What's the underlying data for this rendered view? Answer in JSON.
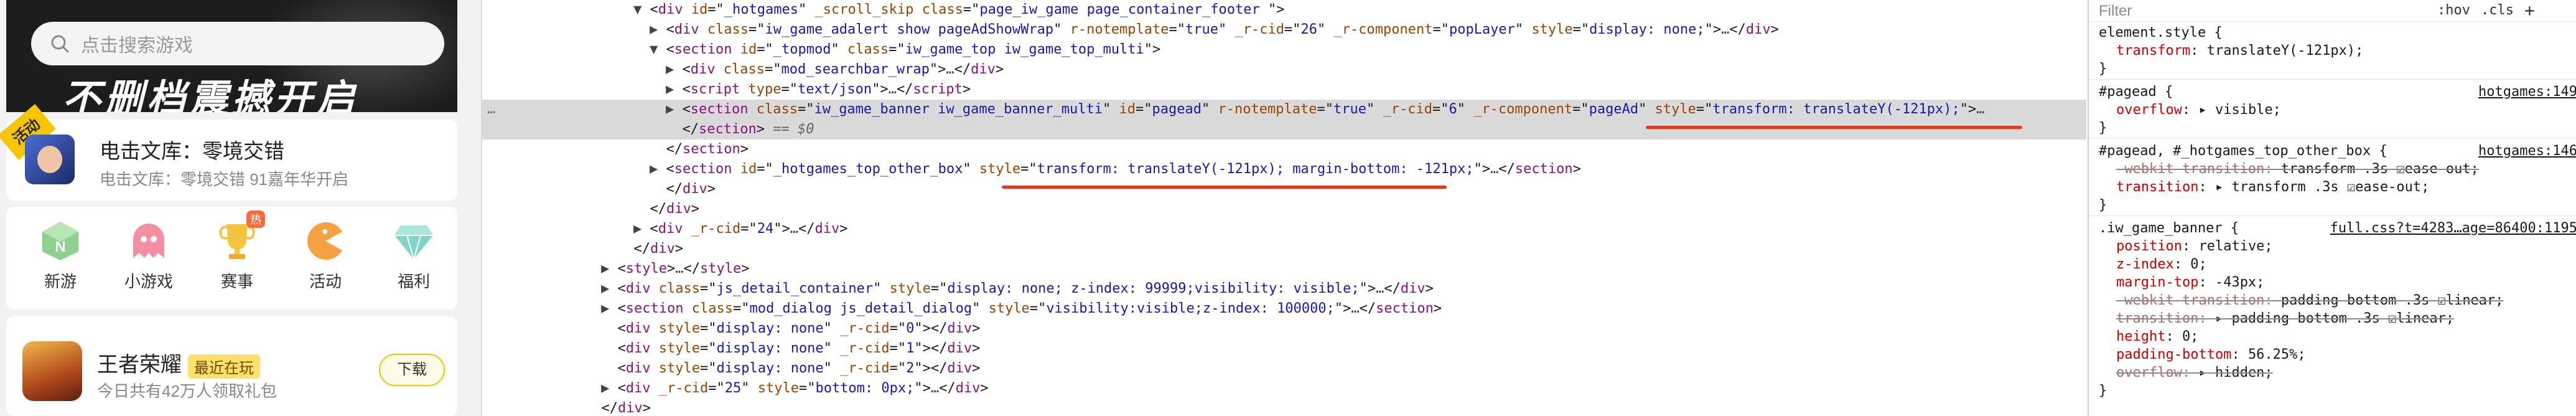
{
  "preview": {
    "search_placeholder": "点击搜索游戏",
    "banner_text": "不删档震撼开启",
    "activity": {
      "badge": "活动",
      "title": "电击文库：零境交错",
      "subtitle": "电击文库：零境交错 91嘉年华开启"
    },
    "nav": [
      {
        "label": "新游",
        "icon": "new-game-icon",
        "color": "#8fd08f"
      },
      {
        "label": "小游戏",
        "icon": "ghost-icon",
        "color": "#f28fa3"
      },
      {
        "label": "赛事",
        "icon": "trophy-icon",
        "color": "#f5c542",
        "badge": "热"
      },
      {
        "label": "活动",
        "icon": "pacman-icon",
        "color": "#f5a142"
      },
      {
        "label": "福利",
        "icon": "diamond-icon",
        "color": "#7fd6c8"
      }
    ],
    "game": {
      "title": "王者荣耀",
      "tag": "最近在玩",
      "subtitle": "今日共有42万人领取礼包",
      "button": "下载"
    }
  },
  "elements": {
    "lines": [
      {
        "indent": 0,
        "tri": "▼",
        "parts": [
          [
            "pun",
            "<"
          ],
          [
            "tag",
            "div"
          ],
          [
            "an",
            " id"
          ],
          [
            "pun",
            "=\""
          ],
          [
            "av",
            "_hotgames"
          ],
          [
            "pun",
            "\" "
          ],
          [
            "an",
            "_scroll_skip"
          ],
          [
            "an",
            " class"
          ],
          [
            "pun",
            "=\""
          ],
          [
            "av",
            "page_iw_game page_container_footer "
          ],
          [
            "pun",
            "\">"
          ]
        ]
      },
      {
        "indent": 1,
        "tri": "▶",
        "parts": [
          [
            "pun",
            "<"
          ],
          [
            "tag",
            "div"
          ],
          [
            "an",
            " class"
          ],
          [
            "pun",
            "=\""
          ],
          [
            "av",
            "iw_game_adalert show pageAdShowWrap"
          ],
          [
            "pun",
            "\" "
          ],
          [
            "an",
            "r-notemplate"
          ],
          [
            "pun",
            "=\""
          ],
          [
            "av",
            "true"
          ],
          [
            "pun",
            "\" "
          ],
          [
            "an",
            "_r-cid"
          ],
          [
            "pun",
            "=\""
          ],
          [
            "av",
            "26"
          ],
          [
            "pun",
            "\" "
          ],
          [
            "an",
            "_r-component"
          ],
          [
            "pun",
            "=\""
          ],
          [
            "av",
            "popLayer"
          ],
          [
            "pun",
            "\" "
          ],
          [
            "an",
            "style"
          ],
          [
            "pun",
            "=\""
          ],
          [
            "av",
            "display: none;"
          ],
          [
            "pun",
            "\">"
          ],
          [
            "ell",
            "…"
          ],
          [
            "pun",
            "</"
          ],
          [
            "tag",
            "div"
          ],
          [
            "pun",
            ">"
          ]
        ]
      },
      {
        "indent": 1,
        "tri": "▼",
        "parts": [
          [
            "pun",
            "<"
          ],
          [
            "tag",
            "section"
          ],
          [
            "an",
            " id"
          ],
          [
            "pun",
            "=\""
          ],
          [
            "av",
            "_topmod"
          ],
          [
            "pun",
            "\" "
          ],
          [
            "an",
            "class"
          ],
          [
            "pun",
            "=\""
          ],
          [
            "av",
            "iw_game_top iw_game_top_multi"
          ],
          [
            "pun",
            "\">"
          ]
        ]
      },
      {
        "indent": 2,
        "tri": "▶",
        "parts": [
          [
            "pun",
            "<"
          ],
          [
            "tag",
            "div"
          ],
          [
            "an",
            " class"
          ],
          [
            "pun",
            "=\""
          ],
          [
            "av",
            "mod_searchbar_wrap"
          ],
          [
            "pun",
            "\">"
          ],
          [
            "ell",
            "…"
          ],
          [
            "pun",
            "</"
          ],
          [
            "tag",
            "div"
          ],
          [
            "pun",
            ">"
          ]
        ]
      },
      {
        "indent": 2,
        "tri": "▶",
        "parts": [
          [
            "pun",
            "<"
          ],
          [
            "tag",
            "script"
          ],
          [
            "an",
            " type"
          ],
          [
            "pun",
            "=\""
          ],
          [
            "av",
            "text/json"
          ],
          [
            "pun",
            "\">"
          ],
          [
            "ell",
            "…"
          ],
          [
            "pun",
            "</"
          ],
          [
            "tag",
            "script"
          ],
          [
            "pun",
            ">"
          ]
        ]
      },
      {
        "indent": 2,
        "tri": "▶",
        "selected": true,
        "parts": [
          [
            "pun",
            "<"
          ],
          [
            "tag",
            "section"
          ],
          [
            "an",
            " class"
          ],
          [
            "pun",
            "=\""
          ],
          [
            "av",
            "iw_game_banner iw_game_banner_multi"
          ],
          [
            "pun",
            "\" "
          ],
          [
            "an",
            "id"
          ],
          [
            "pun",
            "=\""
          ],
          [
            "av",
            "pagead"
          ],
          [
            "pun",
            "\" "
          ],
          [
            "an",
            "r-notemplate"
          ],
          [
            "pun",
            "=\""
          ],
          [
            "av",
            "true"
          ],
          [
            "pun",
            "\" "
          ],
          [
            "an",
            "_r-cid"
          ],
          [
            "pun",
            "=\""
          ],
          [
            "av",
            "6"
          ],
          [
            "pun",
            "\" "
          ],
          [
            "an",
            "_r-component"
          ],
          [
            "pun",
            "=\""
          ],
          [
            "av",
            "pageAd"
          ],
          [
            "pun",
            "\" "
          ],
          [
            "an",
            "style"
          ],
          [
            "pun",
            "=\""
          ],
          [
            "av",
            "transform: translateY(-121px);"
          ],
          [
            "pun",
            "\">"
          ],
          [
            "ell",
            "…"
          ]
        ]
      },
      {
        "indent": 2,
        "tri": "",
        "selected": true,
        "parts": [
          [
            "pun",
            "</"
          ],
          [
            "tag",
            "section"
          ],
          [
            "pun",
            ">"
          ],
          [
            "cmt",
            " == $0"
          ]
        ]
      },
      {
        "indent": 1,
        "tri": "",
        "parts": [
          [
            "pun",
            "</"
          ],
          [
            "tag",
            "section"
          ],
          [
            "pun",
            ">"
          ]
        ]
      },
      {
        "indent": 1,
        "tri": "▶",
        "parts": [
          [
            "pun",
            "<"
          ],
          [
            "tag",
            "section"
          ],
          [
            "an",
            " id"
          ],
          [
            "pun",
            "=\""
          ],
          [
            "av",
            "_hotgames_top_other_box"
          ],
          [
            "pun",
            "\" "
          ],
          [
            "an",
            "style"
          ],
          [
            "pun",
            "=\""
          ],
          [
            "av",
            "transform: translateY(-121px); margin-bottom: -121px;"
          ],
          [
            "pun",
            "\">"
          ],
          [
            "ell",
            "…"
          ],
          [
            "pun",
            "</"
          ],
          [
            "tag",
            "section"
          ],
          [
            "pun",
            ">"
          ]
        ]
      },
      {
        "indent": 1,
        "tri": "",
        "parts": [
          [
            "pun",
            "</"
          ],
          [
            "tag",
            "div"
          ],
          [
            "pun",
            ">"
          ]
        ]
      },
      {
        "indent": 0,
        "tri": "",
        "parts": [
          [
            "pun",
            "</"
          ],
          [
            "tag",
            "div"
          ],
          [
            "pun",
            ">"
          ]
        ]
      },
      {
        "indent": 0,
        "tri": "▶",
        "parts": [
          [
            "pun",
            "<"
          ],
          [
            "tag",
            "div"
          ],
          [
            "an",
            " _r-cid"
          ],
          [
            "pun",
            "=\""
          ],
          [
            "av",
            "24"
          ],
          [
            "pun",
            "\">"
          ],
          [
            "ell",
            "…"
          ],
          [
            "pun",
            "</"
          ],
          [
            "tag",
            "div"
          ],
          [
            "pun",
            ">"
          ]
        ]
      },
      {
        "indent": -1,
        "tri": "",
        "parts": [
          [
            "pun",
            "</"
          ],
          [
            "tag",
            "div"
          ],
          [
            "pun",
            ">"
          ]
        ]
      },
      {
        "indent": -2,
        "tri": "▶",
        "parts": [
          [
            "pun",
            "<"
          ],
          [
            "tag",
            "style"
          ],
          [
            "pun",
            ">"
          ],
          [
            "ell",
            "…"
          ],
          [
            "pun",
            "</"
          ],
          [
            "tag",
            "style"
          ],
          [
            "pun",
            ">"
          ]
        ]
      },
      {
        "indent": -2,
        "tri": "▶",
        "parts": [
          [
            "pun",
            "<"
          ],
          [
            "tag",
            "div"
          ],
          [
            "an",
            " class"
          ],
          [
            "pun",
            "=\""
          ],
          [
            "av",
            "js_detail_container"
          ],
          [
            "pun",
            "\" "
          ],
          [
            "an",
            "style"
          ],
          [
            "pun",
            "=\""
          ],
          [
            "av",
            "display: none; z-index: 99999;visibility: visible;"
          ],
          [
            "pun",
            "\">"
          ],
          [
            "ell",
            "…"
          ],
          [
            "pun",
            "</"
          ],
          [
            "tag",
            "div"
          ],
          [
            "pun",
            ">"
          ]
        ]
      },
      {
        "indent": -2,
        "tri": "▶",
        "parts": [
          [
            "pun",
            "<"
          ],
          [
            "tag",
            "section"
          ],
          [
            "an",
            " class"
          ],
          [
            "pun",
            "=\""
          ],
          [
            "av",
            "mod_dialog js_detail_dialog"
          ],
          [
            "pun",
            "\" "
          ],
          [
            "an",
            "style"
          ],
          [
            "pun",
            "=\""
          ],
          [
            "av",
            "visibility:visible;z-index: 100000;"
          ],
          [
            "pun",
            "\">"
          ],
          [
            "ell",
            "…"
          ],
          [
            "pun",
            "</"
          ],
          [
            "tag",
            "section"
          ],
          [
            "pun",
            ">"
          ]
        ]
      },
      {
        "indent": -2,
        "tri": "",
        "parts": [
          [
            "pun",
            "<"
          ],
          [
            "tag",
            "div"
          ],
          [
            "an",
            " style"
          ],
          [
            "pun",
            "=\""
          ],
          [
            "av",
            "display: none"
          ],
          [
            "pun",
            "\" "
          ],
          [
            "an",
            "_r-cid"
          ],
          [
            "pun",
            "=\""
          ],
          [
            "av",
            "0"
          ],
          [
            "pun",
            "\">"
          ],
          [
            "pun",
            "</"
          ],
          [
            "tag",
            "div"
          ],
          [
            "pun",
            ">"
          ]
        ]
      },
      {
        "indent": -2,
        "tri": "",
        "parts": [
          [
            "pun",
            "<"
          ],
          [
            "tag",
            "div"
          ],
          [
            "an",
            " style"
          ],
          [
            "pun",
            "=\""
          ],
          [
            "av",
            "display: none"
          ],
          [
            "pun",
            "\" "
          ],
          [
            "an",
            "_r-cid"
          ],
          [
            "pun",
            "=\""
          ],
          [
            "av",
            "1"
          ],
          [
            "pun",
            "\">"
          ],
          [
            "pun",
            "</"
          ],
          [
            "tag",
            "div"
          ],
          [
            "pun",
            ">"
          ]
        ]
      },
      {
        "indent": -2,
        "tri": "",
        "parts": [
          [
            "pun",
            "<"
          ],
          [
            "tag",
            "div"
          ],
          [
            "an",
            " style"
          ],
          [
            "pun",
            "=\""
          ],
          [
            "av",
            "display: none"
          ],
          [
            "pun",
            "\" "
          ],
          [
            "an",
            "_r-cid"
          ],
          [
            "pun",
            "=\""
          ],
          [
            "av",
            "2"
          ],
          [
            "pun",
            "\">"
          ],
          [
            "pun",
            "</"
          ],
          [
            "tag",
            "div"
          ],
          [
            "pun",
            ">"
          ]
        ]
      },
      {
        "indent": -2,
        "tri": "▶",
        "parts": [
          [
            "pun",
            "<"
          ],
          [
            "tag",
            "div"
          ],
          [
            "an",
            " _r-cid"
          ],
          [
            "pun",
            "=\""
          ],
          [
            "av",
            "25"
          ],
          [
            "pun",
            "\" "
          ],
          [
            "an",
            "style"
          ],
          [
            "pun",
            "=\""
          ],
          [
            "av",
            "bottom: 0px;"
          ],
          [
            "pun",
            "\">"
          ],
          [
            "ell",
            "…"
          ],
          [
            "pun",
            "</"
          ],
          [
            "tag",
            "div"
          ],
          [
            "pun",
            ">"
          ]
        ]
      },
      {
        "indent": -3,
        "tri": "",
        "parts": [
          [
            "pun",
            "</"
          ],
          [
            "tag",
            "div"
          ],
          [
            "pun",
            ">"
          ]
        ]
      }
    ],
    "dots": "…"
  },
  "styles": {
    "filter_placeholder": "Filter",
    "hov": ":hov",
    "cls": ".cls",
    "plus": "+",
    "rules": [
      {
        "selector": "element.style {",
        "source": "",
        "props": [
          {
            "n": "transform",
            "v": "translateY(-121px);",
            "s": false
          }
        ]
      },
      {
        "selector": "#pagead {",
        "source": "hotgames:149",
        "props": [
          {
            "n": "overflow",
            "v": "▸ visible;",
            "s": false
          }
        ]
      },
      {
        "selector": "#pagead, #_hotgames_top_other_box {",
        "source": "hotgames:146",
        "props": [
          {
            "n": "-webkit-transition",
            "v": "transform .3s ☑ease-out;",
            "s": true
          },
          {
            "n": "transition",
            "v": "▸ transform .3s ☑ease-out;",
            "s": false
          }
        ]
      },
      {
        "selector": ".iw_game_banner {",
        "source": "full.css?t=4283…age=86400:1195",
        "props": [
          {
            "n": "position",
            "v": "relative;",
            "s": false
          },
          {
            "n": "z-index",
            "v": "0;",
            "s": false
          },
          {
            "n": "margin-top",
            "v": "-43px;",
            "s": false
          },
          {
            "n": "-webkit-transition",
            "v": "padding-bottom .3s ☑linear;",
            "s": true
          },
          {
            "n": "transition",
            "v": "▸ padding-bottom .3s ☑linear;",
            "s": true
          },
          {
            "n": "height",
            "v": "0;",
            "s": false
          },
          {
            "n": "padding-bottom",
            "v": "56.25%;",
            "s": false
          },
          {
            "n": "overflow",
            "v": "▸ hidden;",
            "s": true
          }
        ]
      }
    ]
  }
}
